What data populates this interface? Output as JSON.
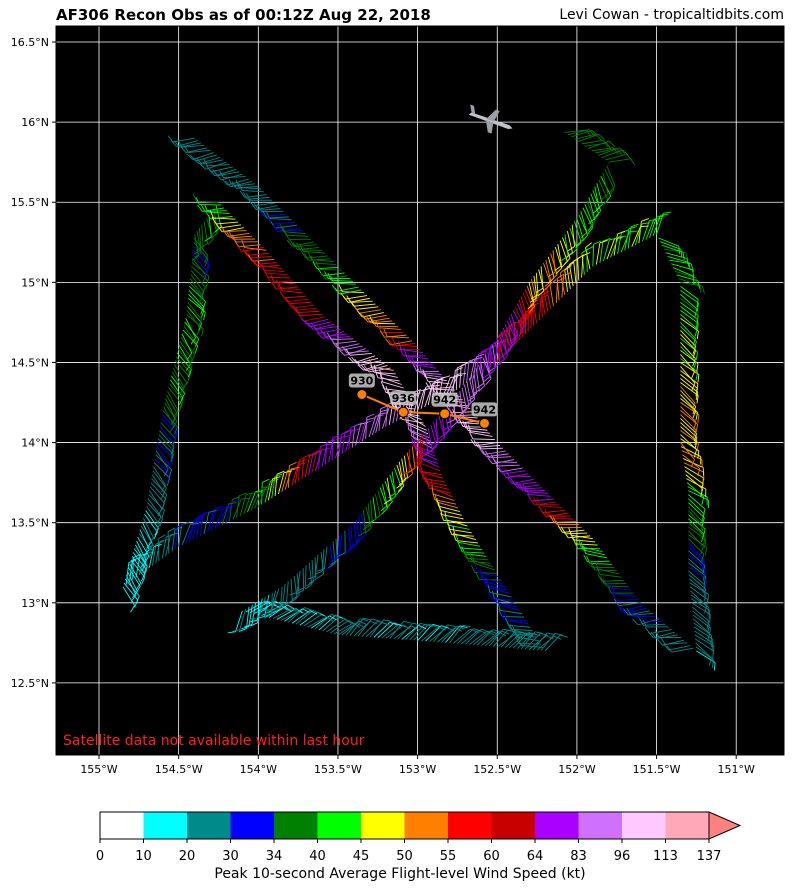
{
  "header": {
    "title": "AF306 Recon Obs as of 00:12Z Aug 22, 2018",
    "credit": "Levi Cowan - tropicaltidbits.com"
  },
  "map": {
    "lat_range": [
      12.05,
      16.6
    ],
    "lon_range": [
      -155.27,
      -150.7
    ],
    "lat_ticks": [
      {
        "v": 16.5,
        "label": "16.5°N"
      },
      {
        "v": 16.0,
        "label": "16°N"
      },
      {
        "v": 15.5,
        "label": "15.5°N"
      },
      {
        "v": 15.0,
        "label": "15°N"
      },
      {
        "v": 14.5,
        "label": "14.5°N"
      },
      {
        "v": 14.0,
        "label": "14°N"
      },
      {
        "v": 13.5,
        "label": "13.5°N"
      },
      {
        "v": 13.0,
        "label": "13°N"
      },
      {
        "v": 12.5,
        "label": "12.5°N"
      }
    ],
    "lon_ticks": [
      {
        "v": -155.0,
        "label": "155°W"
      },
      {
        "v": -154.5,
        "label": "154.5°W"
      },
      {
        "v": -154.0,
        "label": "154°W"
      },
      {
        "v": -153.5,
        "label": "153.5°W"
      },
      {
        "v": -153.0,
        "label": "153°W"
      },
      {
        "v": -152.5,
        "label": "152.5°W"
      },
      {
        "v": -152.0,
        "label": "152°W"
      },
      {
        "v": -151.5,
        "label": "151.5°W"
      },
      {
        "v": -151.0,
        "label": "151°W"
      }
    ],
    "notice": "Satellite data not available within last hour",
    "notice_color": "#ff2020",
    "background": "#000000",
    "grid_color": "#ffffff",
    "aircraft_icon": "plane-icon",
    "aircraft_position": {
      "lat": 16.0,
      "lon": -152.55
    },
    "flight_track": [
      {
        "lat": 15.9,
        "lon": -154.4,
        "wind_kt": 28
      },
      {
        "lat": 15.6,
        "lon": -154.0,
        "wind_kt": 22
      },
      {
        "lat": 15.2,
        "lon": -153.6,
        "wind_kt": 37
      },
      {
        "lat": 14.9,
        "lon": -153.3,
        "wind_kt": 47
      },
      {
        "lat": 14.6,
        "lon": -153.0,
        "wind_kt": 58
      },
      {
        "lat": 14.25,
        "lon": -152.7,
        "wind_kt": 120
      },
      {
        "lat": 14.0,
        "lon": -152.5,
        "wind_kt": 100
      },
      {
        "lat": 13.7,
        "lon": -152.2,
        "wind_kt": 70
      },
      {
        "lat": 13.4,
        "lon": -151.9,
        "wind_kt": 46
      },
      {
        "lat": 13.0,
        "lon": -151.6,
        "wind_kt": 32
      },
      {
        "lat": 12.7,
        "lon": -151.25,
        "wind_kt": 22
      },
      {
        "lat": 13.2,
        "lon": -151.3,
        "wind_kt": 29
      },
      {
        "lat": 13.7,
        "lon": -151.3,
        "wind_kt": 44
      },
      {
        "lat": 14.0,
        "lon": -151.35,
        "wind_kt": 52
      },
      {
        "lat": 14.5,
        "lon": -151.35,
        "wind_kt": 46
      },
      {
        "lat": 15.0,
        "lon": -151.35,
        "wind_kt": 41
      },
      {
        "lat": 15.3,
        "lon": -151.5,
        "wind_kt": 42
      },
      {
        "lat": 15.1,
        "lon": -151.9,
        "wind_kt": 44
      },
      {
        "lat": 14.8,
        "lon": -152.2,
        "wind_kt": 56
      },
      {
        "lat": 14.5,
        "lon": -152.5,
        "wind_kt": 62
      },
      {
        "lat": 14.3,
        "lon": -152.8,
        "wind_kt": 105
      },
      {
        "lat": 14.1,
        "lon": -153.2,
        "wind_kt": 95
      },
      {
        "lat": 13.85,
        "lon": -153.6,
        "wind_kt": 70
      },
      {
        "lat": 13.6,
        "lon": -154.0,
        "wind_kt": 40
      },
      {
        "lat": 13.35,
        "lon": -154.5,
        "wind_kt": 28
      },
      {
        "lat": 13.1,
        "lon": -154.85,
        "wind_kt": 14
      },
      {
        "lat": 13.6,
        "lon": -154.7,
        "wind_kt": 20
      },
      {
        "lat": 14.2,
        "lon": -154.6,
        "wind_kt": 36
      },
      {
        "lat": 14.8,
        "lon": -154.45,
        "wind_kt": 40
      },
      {
        "lat": 15.3,
        "lon": -154.4,
        "wind_kt": 35
      },
      {
        "lat": 15.5,
        "lon": -154.25,
        "wind_kt": 42
      },
      {
        "lat": 15.2,
        "lon": -153.95,
        "wind_kt": 57
      },
      {
        "lat": 14.8,
        "lon": -153.6,
        "wind_kt": 60
      },
      {
        "lat": 14.45,
        "lon": -153.15,
        "wind_kt": 115
      },
      {
        "lat": 14.1,
        "lon": -152.95,
        "wind_kt": 105
      },
      {
        "lat": 13.8,
        "lon": -152.85,
        "wind_kt": 60
      },
      {
        "lat": 13.5,
        "lon": -152.7,
        "wind_kt": 48
      },
      {
        "lat": 13.1,
        "lon": -152.45,
        "wind_kt": 33
      },
      {
        "lat": 12.7,
        "lon": -152.2,
        "wind_kt": 26
      },
      {
        "lat": 12.75,
        "lon": -152.8,
        "wind_kt": 22
      },
      {
        "lat": 12.8,
        "lon": -153.5,
        "wind_kt": 22
      },
      {
        "lat": 12.95,
        "lon": -154.1,
        "wind_kt": 17
      },
      {
        "lat": 13.1,
        "lon": -153.85,
        "wind_kt": 24
      },
      {
        "lat": 13.5,
        "lon": -153.4,
        "wind_kt": 32
      },
      {
        "lat": 13.9,
        "lon": -153.1,
        "wind_kt": 48
      },
      {
        "lat": 14.3,
        "lon": -152.75,
        "wind_kt": 90
      },
      {
        "lat": 14.65,
        "lon": -152.5,
        "wind_kt": 82
      },
      {
        "lat": 15.0,
        "lon": -152.3,
        "wind_kt": 52
      },
      {
        "lat": 15.4,
        "lon": -152.0,
        "wind_kt": 44
      },
      {
        "lat": 15.75,
        "lon": -151.8,
        "wind_kt": 38
      },
      {
        "lat": 15.95,
        "lon": -152.1,
        "wind_kt": 36
      }
    ],
    "center_fixes": [
      {
        "pressure": "930",
        "lat": 14.3,
        "lon": -153.35
      },
      {
        "pressure": "936",
        "lat": 14.19,
        "lon": -153.09
      },
      {
        "pressure": "942",
        "lat": 14.18,
        "lon": -152.83
      },
      {
        "pressure": "942",
        "lat": 14.12,
        "lon": -152.58
      }
    ]
  },
  "colorbar": {
    "title": "Peak 10-second Average Flight-level Wind Speed (kt)",
    "ticks": [
      "0",
      "10",
      "20",
      "30",
      "34",
      "40",
      "45",
      "50",
      "55",
      "60",
      "64",
      "83",
      "96",
      "113",
      "137"
    ],
    "colors": [
      "#ffffff",
      "#00ffff",
      "#008b8b",
      "#0000ff",
      "#008000",
      "#00ff00",
      "#ffff00",
      "#ff8000",
      "#ff0000",
      "#c80000",
      "#aa00ff",
      "#d070ff",
      "#ffcaff",
      "#ffa8b8"
    ],
    "extend_color": "#ff8080"
  }
}
